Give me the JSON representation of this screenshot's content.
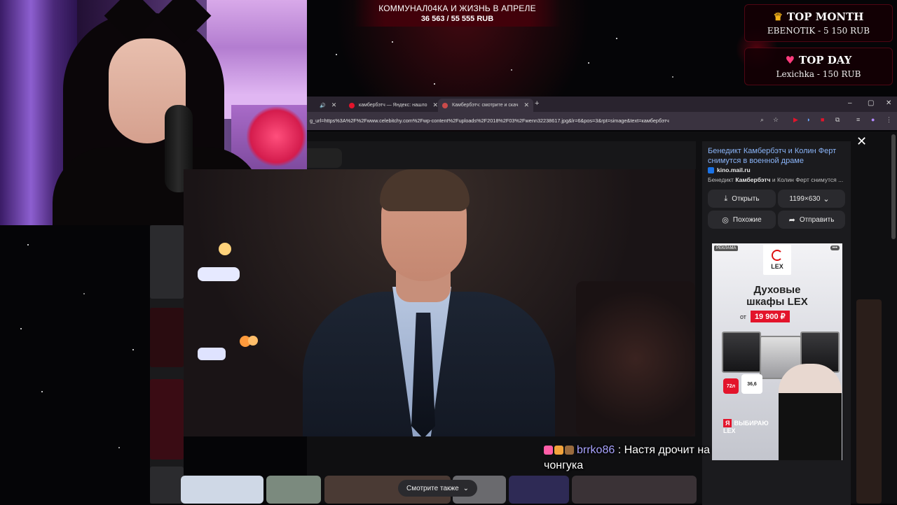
{
  "overlay": {
    "goal_title": "КОММУНАЛ04КА И ЖИЗНЬ В АПРЕЛЕ",
    "goal_progress": "36 563 / 55 555 RUB",
    "top_month": {
      "title": "TOP MONTH",
      "value": "EBENOTIK  -  5 150 RUB",
      "icon": "crown-icon"
    },
    "top_day": {
      "title": "TOP DAY",
      "value": "Lexichka  -  150 RUB",
      "icon": "heart-icon"
    }
  },
  "browser": {
    "tabs": [
      {
        "label": "камбербэтч — Яндекс: нашло",
        "favicon_color": "#e3142b"
      },
      {
        "label": "Камбербэтч: смотрите и скач",
        "favicon_color": "#c94a4a",
        "active": true
      }
    ],
    "new_tab": "+",
    "window_controls": [
      "–",
      "▢",
      "✕"
    ],
    "url": "g_url=https%3A%2F%2Fwww.celebitchy.com%2Fwp-content%2Fuploads%2F2018%2F03%2Fwenn32238617.jpg&lr=6&pos=3&rpt=simage&text=камбербэтч"
  },
  "viewer": {
    "title": "Бенедикт Камбербэтч и Колин Ферт снимутся в военной драме",
    "source": "kino.mail.ru",
    "desc_bold": "Камбербэтч",
    "desc_pre": "Бенедикт ",
    "desc_post": " и Колин Ферт снимутся ...",
    "open_label": "Открыть",
    "size_label": "1199×630",
    "similar_label": "Похожие",
    "share_label": "Отправить",
    "see_also_label": "Смотрите также",
    "close": "✕"
  },
  "ad": {
    "tag": "РЕКЛАМА",
    "more": "•••",
    "brand": "LEX",
    "headline_1": "Духовые",
    "headline_2": "шкафы LEX",
    "price_from": "от",
    "price": "19 900 ₽",
    "badge_1": "72л",
    "badge_2": "36,6",
    "slogan_y": "Я",
    "slogan_1": "ВЫБИРАЮ",
    "slogan_2": "LEX"
  },
  "chat": {
    "user": "brrko86",
    "separator": " : ",
    "message": "Настя дрочит на чонгука"
  },
  "colors": {
    "accent_red": "#e3142b",
    "link": "#8ab4f8",
    "chat_user": "#a9a3ff"
  }
}
